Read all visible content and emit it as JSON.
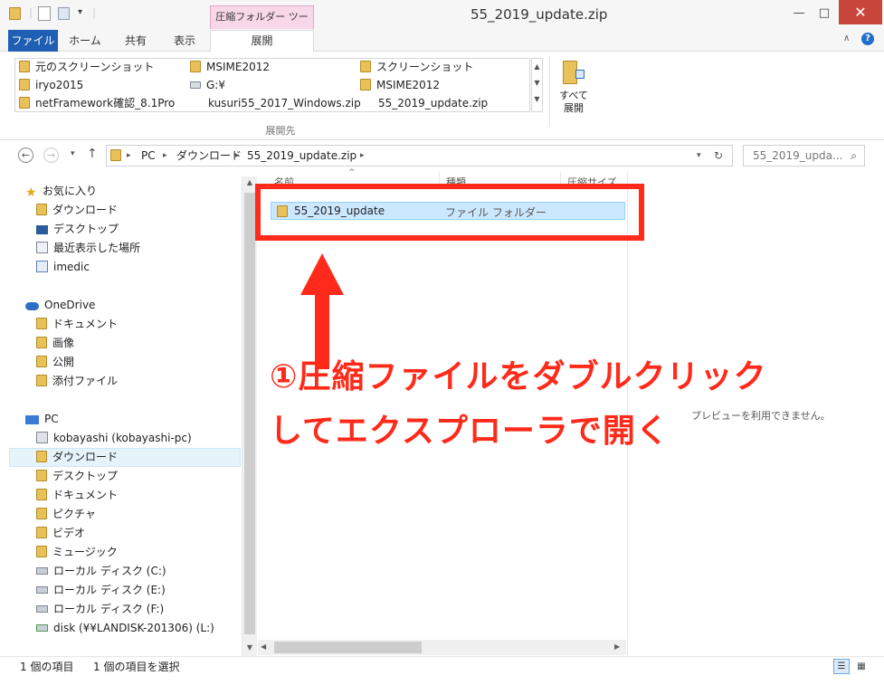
{
  "window": {
    "title": "55_2019_update.zip",
    "context_tab": "圧縮フォルダー ツール",
    "minimize": "—",
    "maximize": "□",
    "close": "✕"
  },
  "ribbon": {
    "tabs": [
      "ファイル",
      "ホーム",
      "共有",
      "表示",
      "展開"
    ],
    "gallery": [
      "元のスクリーンショット",
      "MSIME2012",
      "スクリーンショット",
      "iryo2015",
      "G:¥",
      "MSIME2012",
      "netFramework確認_8.1Pro",
      "kusuri55_2017_Windows.zip",
      "55_2019_update.zip"
    ],
    "group_label": "展開先",
    "extract_all": [
      "すべて",
      "展開"
    ]
  },
  "address": {
    "crumbs": [
      "PC",
      "ダウンロード",
      "55_2019_update.zip"
    ],
    "search_placeholder": "55_2019_upda..."
  },
  "nav": {
    "favorites": "お気に入り",
    "fav_items": [
      "ダウンロード",
      "デスクトップ",
      "最近表示した場所",
      "imedic"
    ],
    "onedrive": "OneDrive",
    "od_items": [
      "ドキュメント",
      "画像",
      "公開",
      "添付ファイル"
    ],
    "pc": "PC",
    "pc_items": [
      "kobayashi (kobayashi-pc)",
      "ダウンロード",
      "デスクトップ",
      "ドキュメント",
      "ピクチャ",
      "ビデオ",
      "ミュージック",
      "ローカル ディスク (C:)",
      "ローカル ディスク (E:)",
      "ローカル ディスク (F:)",
      "disk (¥¥LANDISK-201306) (L:)"
    ]
  },
  "files": {
    "headers": [
      "名前",
      "種類",
      "圧縮サイズ"
    ],
    "rows": [
      {
        "name": "55_2019_update",
        "type": "ファイル フォルダー"
      }
    ]
  },
  "preview_text": "プレビューを利用できません。",
  "status": {
    "count": "1 個の項目",
    "selected": "1 個の項目を選択"
  },
  "annotation": {
    "line1": "①圧縮ファイルをダブルクリック",
    "line2": "してエクスプローラで開く",
    "color": "#ff2a1a"
  }
}
